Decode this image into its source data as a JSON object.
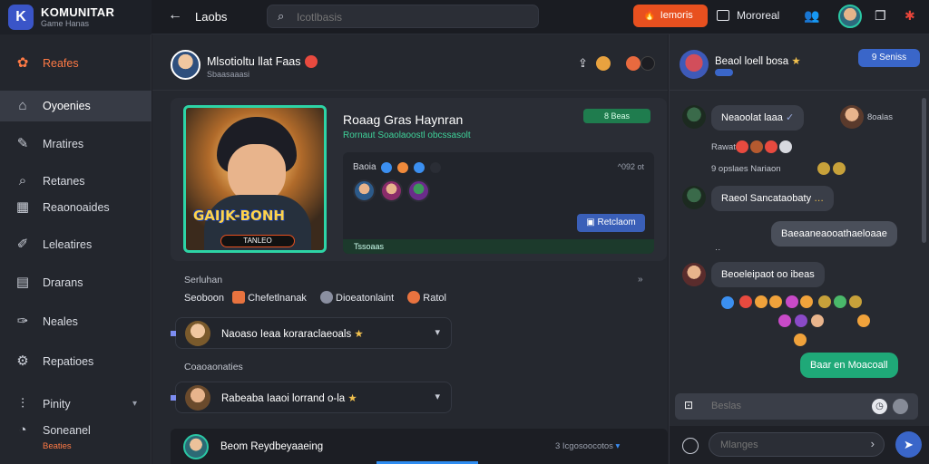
{
  "brand": {
    "name": "KOMUNITAR",
    "subtitle": "Game Hanas",
    "logo_letter": "K"
  },
  "topbar": {
    "title": "Laobs",
    "search_placeholder": "Icotlbasis",
    "cta_label": "Iemoris",
    "nav_label": "Mororeal"
  },
  "sidebar": {
    "items": [
      {
        "label": "Reafes",
        "icon": "game-icon"
      },
      {
        "label": "Oyoenies",
        "icon": "home-icon"
      },
      {
        "label": "Mratires",
        "icon": "pencil-icon"
      },
      {
        "label": "Retanes",
        "icon": "search-icon"
      },
      {
        "label": "Reaonoaides",
        "icon": "calendar-icon"
      },
      {
        "label": "Leleatires",
        "icon": "edit-icon"
      },
      {
        "label": "Drarans",
        "icon": "document-icon"
      },
      {
        "label": "Neales",
        "icon": "wrench-icon"
      },
      {
        "label": "Repatioes",
        "icon": "settings-icon"
      },
      {
        "label": "Pinity",
        "icon": "chart-icon"
      },
      {
        "label": "Soneanel",
        "icon": "user-icon"
      }
    ],
    "sub_label": "Beaties"
  },
  "post": {
    "title": "Mlsotioltu llat Faas",
    "subtitle": "Sbaasaaasi",
    "game": {
      "title": "Roaag Gras Haynran",
      "subtitle": "Rornaut Soaolaoostl obcssasolt",
      "tag": "8 Beas",
      "art_logo": "GAIJK-BONH",
      "art_badge": "TANLEO",
      "inner_label": "Baoia",
      "inner_right": "^092 ot",
      "button_label": "Retclaom",
      "footer_label": "Tssoaas"
    },
    "section1_label": "Serluhan",
    "section1_more": "»",
    "chips": [
      "Seoboon",
      "Chefetlnanak",
      "Dioeatonlaint",
      "Ratol"
    ],
    "dropdown1": "Naoaso Ieaa koraraclaeoals",
    "section2_label": "Coaoaonaties",
    "dropdown2": "Rabeaba Iaaoi lorrand o-la"
  },
  "bottom": {
    "text": "Beom Reydbeyaaeing",
    "right": "3 Icgosoocotos"
  },
  "chat": {
    "name": "Beaol loell bosa",
    "pill_label": "9 Seniss",
    "messages": [
      {
        "text": "Neaoolat laaa",
        "type": "in"
      },
      {
        "meta": "8oalas"
      },
      {
        "meta": "Rawatas"
      },
      {
        "meta": "9 opslaes Nariaon"
      },
      {
        "text": "Raeol Sancataobaty",
        "type": "in"
      },
      {
        "text": "Baeaaneaooathaeloaae",
        "type": "out"
      },
      {
        "text": "Beoeleipaot oo ibeas",
        "type": "in"
      },
      {
        "text": "Baar en Moacoall",
        "type": "green"
      }
    ],
    "composer_placeholder": "Beslas",
    "send_placeholder": "Mlanges"
  }
}
